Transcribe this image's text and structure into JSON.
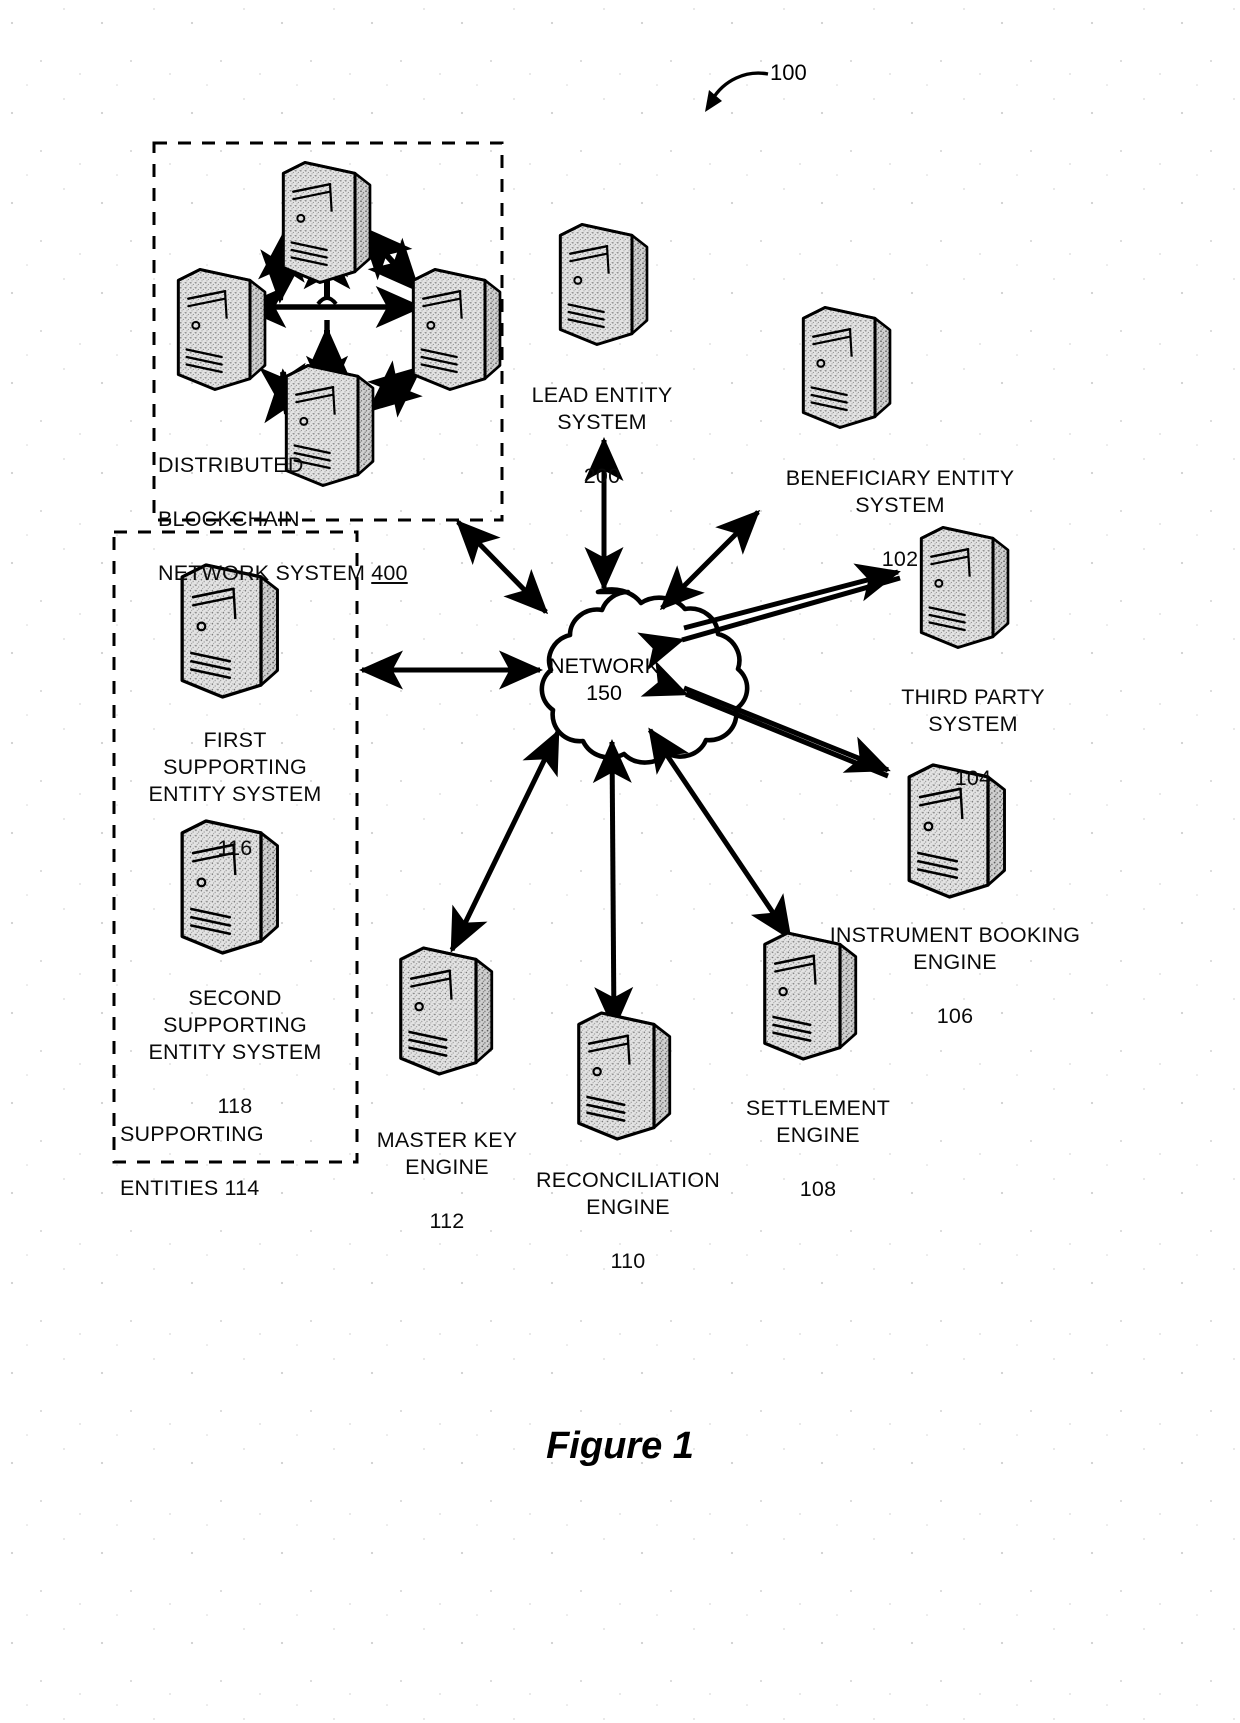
{
  "figure": {
    "caption": "Figure 1",
    "reference_numeral": "100"
  },
  "groups": [
    {
      "id": "distributed-blockchain-network-system",
      "label_lines": [
        "DISTRIBUTED",
        "BLOCKCHAIN",
        "NETWORK SYSTEM "
      ],
      "label": "DISTRIBUTED BLOCKCHAIN NETWORK SYSTEM 400",
      "numeral": "400",
      "numeral_underlined": true,
      "node_count": 5
    },
    {
      "id": "supporting-entities",
      "label_lines": [
        "SUPPORTING",
        "ENTITIES 114"
      ],
      "label": "SUPPORTING ENTITIES 114",
      "numeral": "114"
    }
  ],
  "network": {
    "name": "NETWORK",
    "numeral": "150"
  },
  "nodes": [
    {
      "id": "lead-entity-system",
      "name": "LEAD ENTITY\nSYSTEM",
      "numeral": "200"
    },
    {
      "id": "beneficiary-entity-system",
      "name": "BENEFICIARY ENTITY\nSYSTEM",
      "numeral": "102"
    },
    {
      "id": "third-party-system",
      "name": "THIRD PARTY\nSYSTEM",
      "numeral": "104"
    },
    {
      "id": "instrument-booking-engine",
      "name": "INSTRUMENT BOOKING\nENGINE",
      "numeral": "106"
    },
    {
      "id": "settlement-engine",
      "name": "SETTLEMENT\nENGINE",
      "numeral": "108"
    },
    {
      "id": "reconciliation-engine",
      "name": "RECONCILIATION\nENGINE",
      "numeral": "110"
    },
    {
      "id": "master-key-engine",
      "name": "MASTER KEY\nENGINE",
      "numeral": "112"
    },
    {
      "id": "first-supporting-entity-system",
      "name": "FIRST\nSUPPORTING\nENTITY SYSTEM",
      "numeral": "116"
    },
    {
      "id": "second-supporting-entity-system",
      "name": "SECOND\nSUPPORTING\nENTITY SYSTEM",
      "numeral": "118"
    }
  ],
  "colors": {
    "ink": "#000000",
    "paper": "#ffffff",
    "server_fill": "#d7d7d7"
  }
}
